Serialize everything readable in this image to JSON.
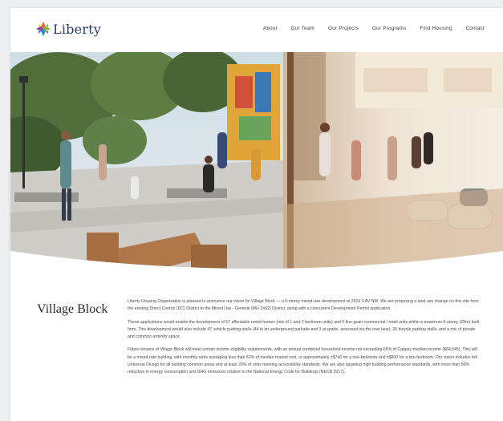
{
  "brand": {
    "name": "Liberty"
  },
  "nav": {
    "items": [
      "About",
      "Our Team",
      "Our Projects",
      "Our Programs",
      "Find Housing",
      "Contact"
    ]
  },
  "hero": {
    "alt_scene": "rendering-plaza-and-lobby",
    "colors": {
      "sky": "#d7e3ea",
      "trees": "#4f6e3a",
      "paving": "#cfcdc7",
      "mural": "#e1a63a",
      "wood": "#b07849",
      "glass": "#e9dccb"
    }
  },
  "content": {
    "title": "Village Block",
    "paragraphs": [
      "Liberty Housing Organization is pleased to announce our vision for Village Block — a 6-storey mixed-use development at 2416 3 AV NW. We are proposing a land use change on this site from the existing Direct Control (DC) District to the Mixed Use - General (MU-1h62) District, along with a concurrent Development Permit application.",
      "These applications would enable the development of 57 affordable rental homes (mix of 1 and 2 bedroom units) and 5 fine-grain commercial / retail units within a maximum 6-storey (28m) built form. This development would also include 47 vehicle parking stalls (44 in an underground parkade and 3 at-grade, accessed via the rear lane), 26 bicycle parking stalls, and a mix of private and common amenity space.",
      "Future tenants of Village Block will meet certain income eligibility requirements, with an annual combined household income not exceeding 65% of Calgary median income ($64,545). This will be a mixed-rate building, with monthly rents averaging less than 63% of median market rent, or approximately ±$740 for a one-bedroom and ±$800 for a two-bedroom. Our vision includes full Universal Design for all building common areas and at least 20% of units meeting accessibility standards. We are also targeting high building performance standards, with more than 50% reduction in energy consumption and GHG emissions relative to the National Energy Code for Buildings (NECB 2017)."
    ]
  }
}
